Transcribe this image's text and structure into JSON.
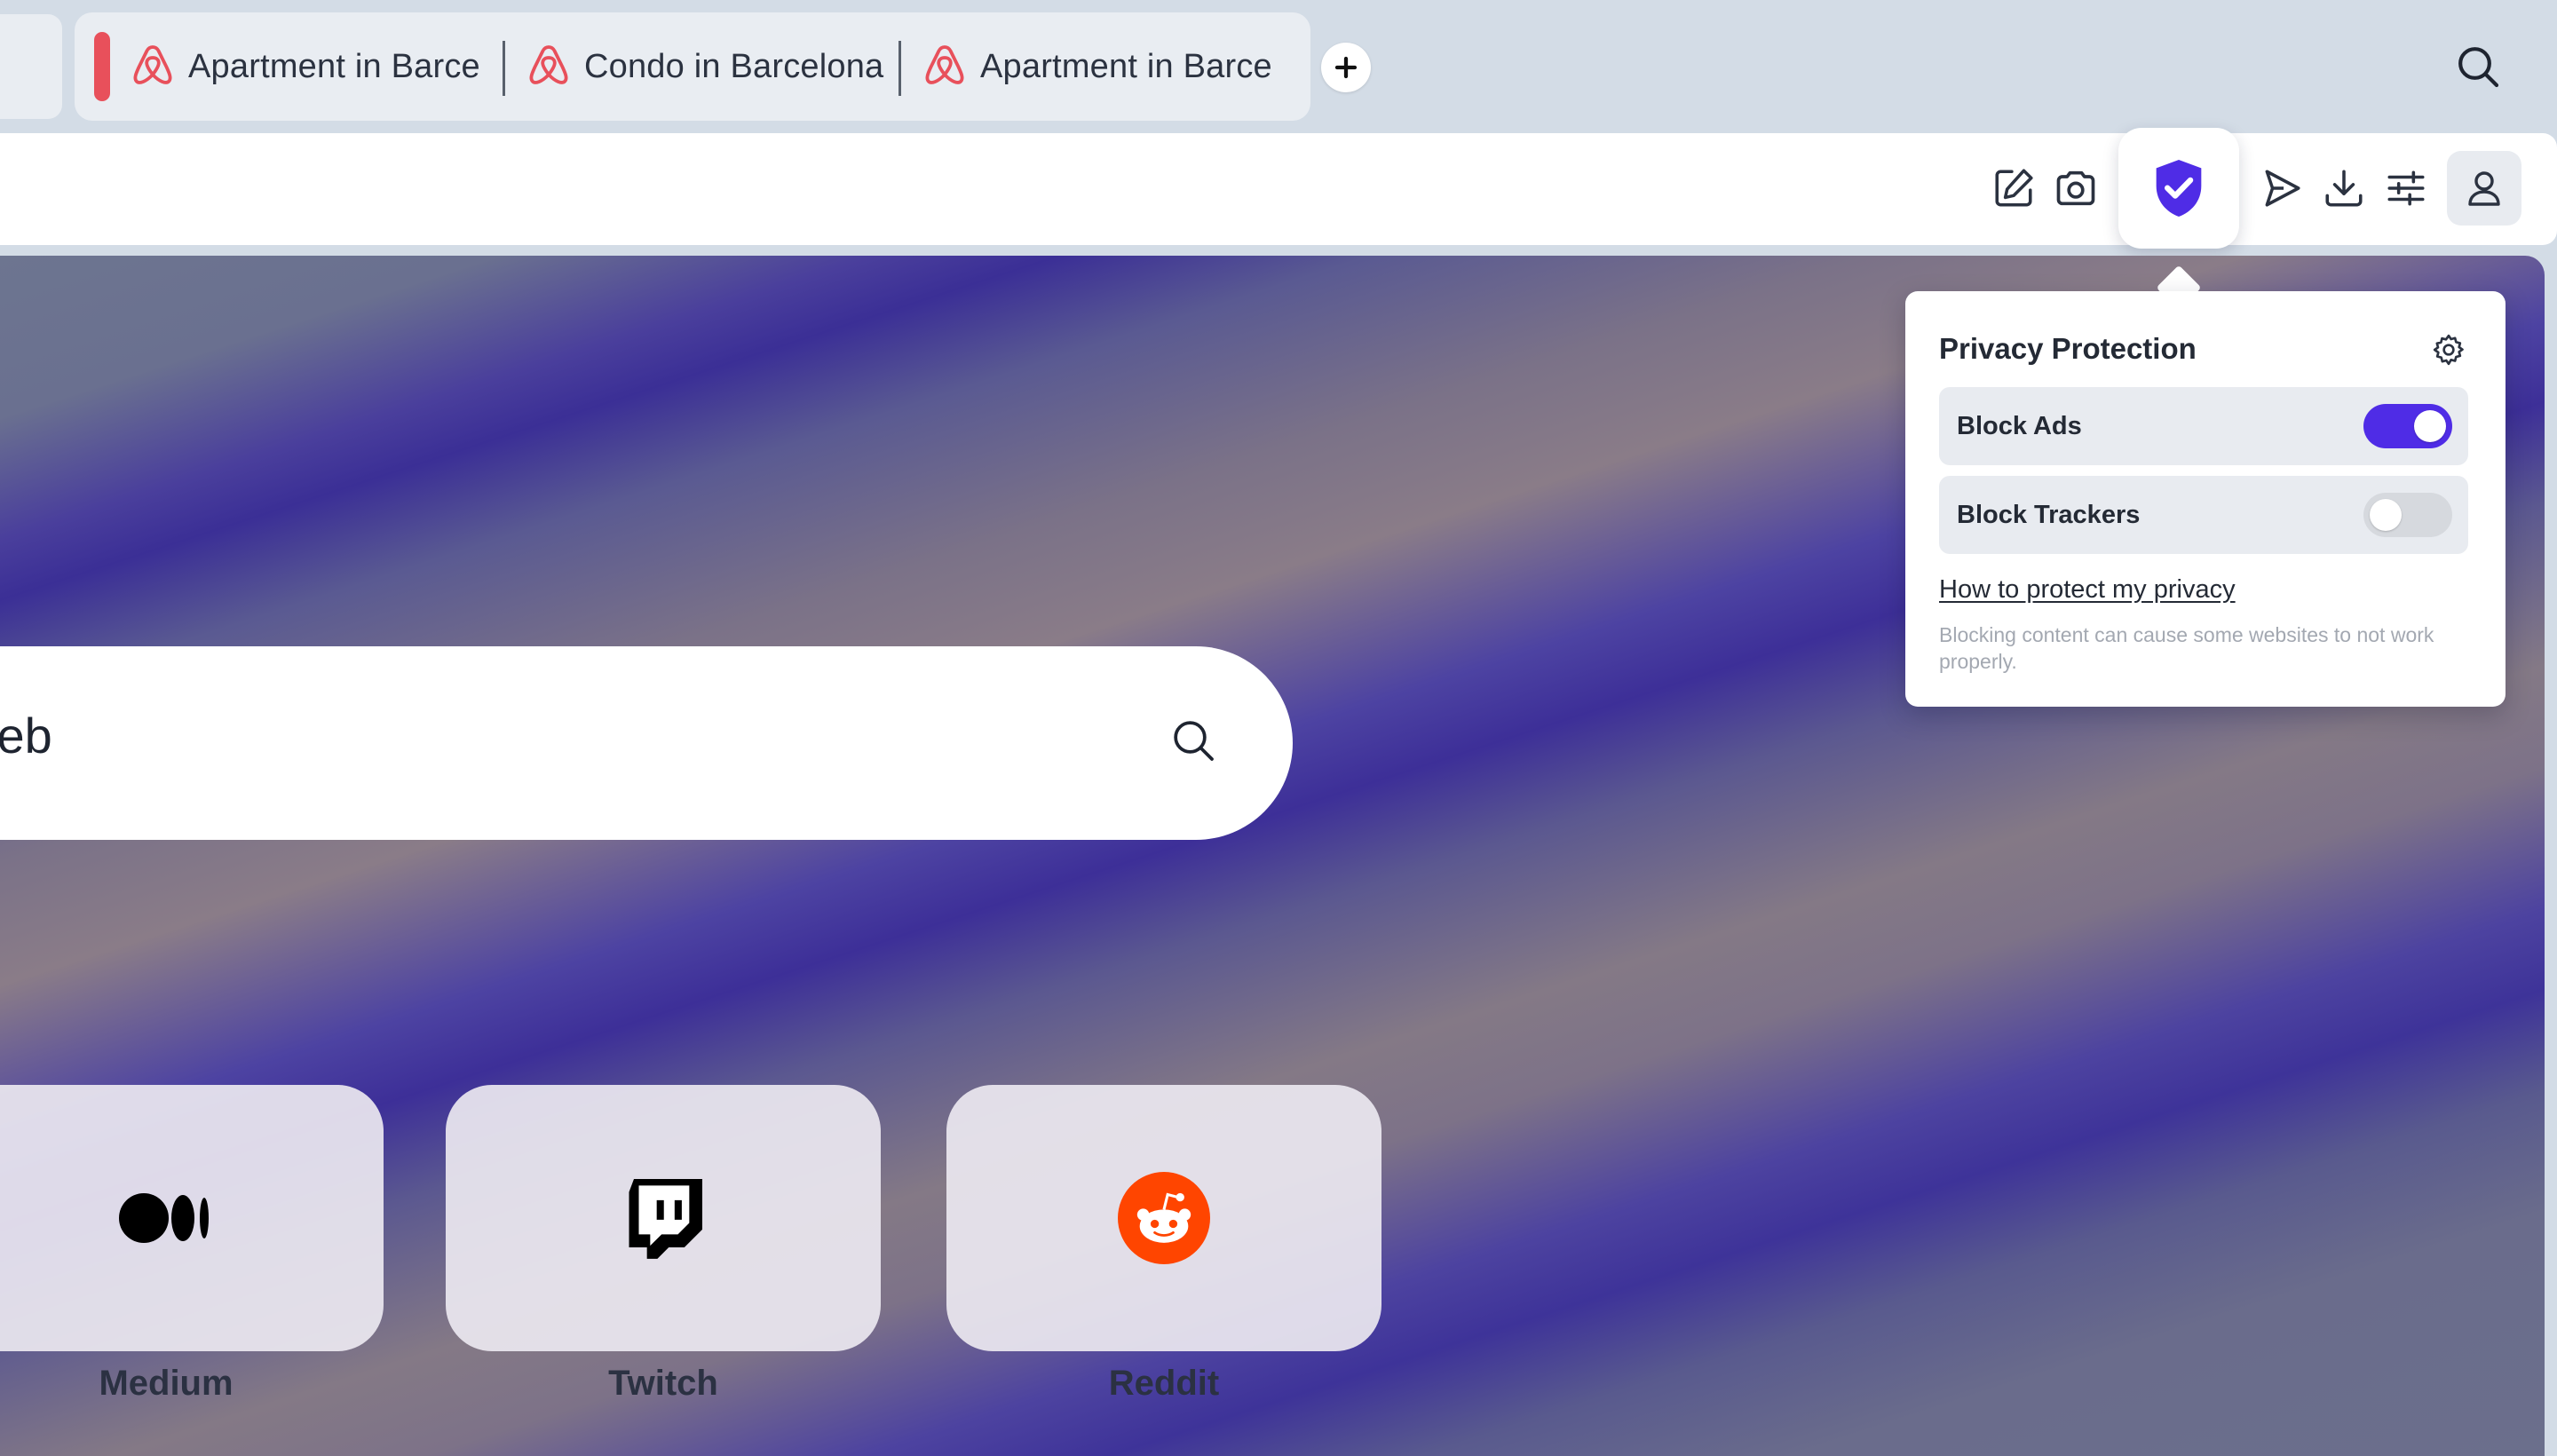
{
  "colors": {
    "accent": "#4f2ce6",
    "airbnb": "#e8505b",
    "reddit": "#ff4500",
    "toggle_off": "#d6d9de"
  },
  "tabs": [
    {
      "label": "Apartment in Barce",
      "icon": "airbnb-icon"
    },
    {
      "label": "Condo in Barcelona",
      "icon": "airbnb-icon"
    },
    {
      "label": "Apartment in Barce",
      "icon": "airbnb-icon"
    }
  ],
  "search": {
    "visible_text": "web"
  },
  "tiles": [
    {
      "label": "Medium",
      "icon": "medium-icon"
    },
    {
      "label": "Twitch",
      "icon": "twitch-icon"
    },
    {
      "label": "Reddit",
      "icon": "reddit-icon"
    }
  ],
  "toolbar": {
    "icons": [
      "edit-icon",
      "camera-icon",
      "shield-check-icon",
      "send-icon",
      "download-icon",
      "sliders-icon",
      "profile-icon"
    ]
  },
  "privacy": {
    "title": "Privacy Protection",
    "rows": [
      {
        "label": "Block Ads",
        "enabled": true
      },
      {
        "label": "Block Trackers",
        "enabled": false
      }
    ],
    "link": "How to protect my privacy",
    "note": "Blocking content can cause some websites to not work properly."
  }
}
